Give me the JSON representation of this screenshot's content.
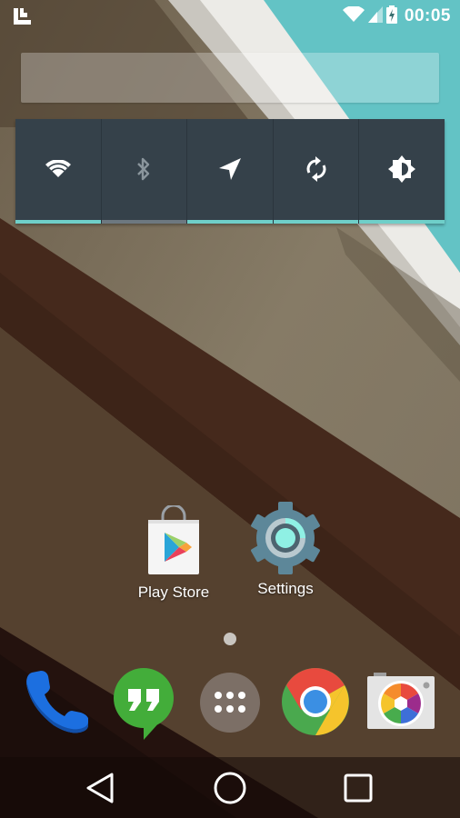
{
  "status_bar": {
    "notification_icon": "launcher-notification-icon",
    "wifi_icon": "wifi-icon",
    "signal_icon": "cell-signal-icon",
    "battery_icon": "battery-charging-icon",
    "time": "00:05"
  },
  "search_bar": {
    "placeholder": ""
  },
  "quick_settings": {
    "tiles": [
      {
        "name": "wifi",
        "icon": "wifi-icon",
        "state": "on",
        "indicator_color": "#6fcfc9"
      },
      {
        "name": "bluetooth",
        "icon": "bluetooth-icon",
        "state": "off",
        "indicator_color": "#6d7880"
      },
      {
        "name": "location",
        "icon": "location-arrow-icon",
        "state": "on",
        "indicator_color": "#6fcfc9"
      },
      {
        "name": "sync",
        "icon": "sync-icon",
        "state": "on",
        "indicator_color": "#6fcfc9"
      },
      {
        "name": "brightness",
        "icon": "brightness-icon",
        "state": "on",
        "indicator_color": "#6fcfc9"
      }
    ]
  },
  "home_apps": [
    {
      "label": "Play Store",
      "icon": "play-store-icon"
    },
    {
      "label": "Settings",
      "icon": "settings-gear-icon"
    }
  ],
  "page_indicator": {
    "pages": 1,
    "current": 1
  },
  "dock": [
    {
      "name": "Phone",
      "icon": "phone-icon"
    },
    {
      "name": "Hangouts",
      "icon": "hangouts-icon"
    },
    {
      "name": "App Drawer",
      "icon": "app-drawer-icon"
    },
    {
      "name": "Chrome",
      "icon": "chrome-icon"
    },
    {
      "name": "Camera",
      "icon": "camera-icon"
    }
  ],
  "nav_bar": {
    "back": "back-icon",
    "home": "home-icon",
    "recents": "recents-icon"
  },
  "colors": {
    "accent_teal": "#6fcfc9",
    "widget_bg": "#35414a",
    "wallpaper_teal": "#63c3c5"
  }
}
